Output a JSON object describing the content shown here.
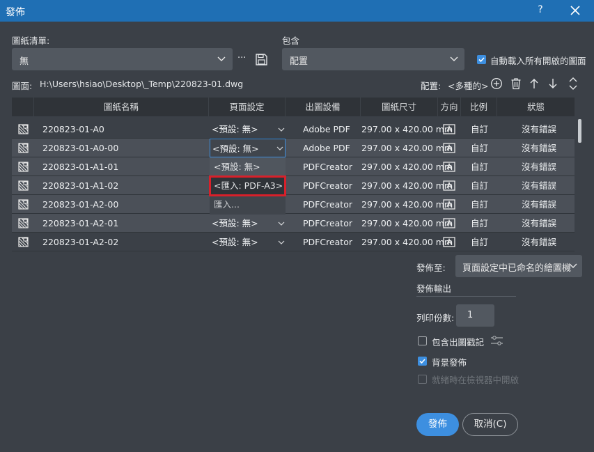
{
  "window": {
    "title": "發佈",
    "help": "?"
  },
  "sheet_list": {
    "label": "圖紙清單:",
    "value": "無",
    "more": "···"
  },
  "include": {
    "label": "包含",
    "value": "配置"
  },
  "auto_load": {
    "label": "自動載入所有開啟的圖面",
    "checked": true
  },
  "drawing": {
    "label": "圖面:",
    "path": "H:\\Users\\hsiao\\Desktop\\_Temp\\220823-01.dwg"
  },
  "layout": {
    "label": "配置:",
    "value": "<多種的>"
  },
  "table": {
    "headers": [
      "圖紙名稱",
      "頁面設定",
      "出圖設備",
      "圖紙尺寸",
      "方向",
      "比例",
      "狀態"
    ],
    "rows": [
      {
        "name": "220823-01-A0",
        "page_setup": "<預設: 無>",
        "device": "Adobe PDF",
        "size": "297.00 x 420.00 mm",
        "scale": "自訂",
        "status": "沒有錯誤"
      },
      {
        "name": "220823-01-A0-00",
        "page_setup": "<預設: 無>",
        "device": "Adobe PDF",
        "size": "297.00 x 420.00 mm",
        "scale": "自訂",
        "status": "沒有錯誤"
      },
      {
        "name": "220823-01-A1-01",
        "page_setup": "",
        "device": "PDFCreator",
        "size": "297.00 x 420.00 mm",
        "scale": "自訂",
        "status": "沒有錯誤"
      },
      {
        "name": "220823-01-A1-02",
        "page_setup": "",
        "device": "PDFCreator",
        "size": "297.00 x 420.00 mm",
        "scale": "自訂",
        "status": "沒有錯誤"
      },
      {
        "name": "220823-01-A2-00",
        "page_setup": "",
        "device": "PDFCreator",
        "size": "297.00 x 420.00 mm",
        "scale": "自訂",
        "status": "沒有錯誤"
      },
      {
        "name": "220823-01-A2-01",
        "page_setup": "<預設: 無>",
        "device": "PDFCreator",
        "size": "297.00 x 420.00 mm",
        "scale": "自訂",
        "status": "沒有錯誤"
      },
      {
        "name": "220823-01-A2-02",
        "page_setup": "<預設: 無>",
        "device": "PDFCreator",
        "size": "297.00 x 420.00 mm",
        "scale": "自訂",
        "status": "沒有錯誤"
      }
    ]
  },
  "dropdown": {
    "selected": "<預設: 無>",
    "options": [
      "<預設: 無>",
      "<匯入: PDF-A3>",
      "匯入..."
    ]
  },
  "publish_to": {
    "label": "發佈至:",
    "value": "頁面設定中已命名的繪圖機"
  },
  "publish_output": {
    "label": "發佈輸出"
  },
  "copies": {
    "label": "列印份數:",
    "value": "1"
  },
  "include_stamp": {
    "label": "包含出圖戳記",
    "checked": false
  },
  "background": {
    "label": "背景發佈",
    "checked": true
  },
  "open_viewer": {
    "label": "就緒時在檢視器中開啟",
    "checked": false,
    "disabled": true
  },
  "buttons": {
    "publish": "發佈",
    "cancel": "取消(C)"
  },
  "colors": {
    "accent": "#3d8fe0",
    "titlebar": "#1f6fb4",
    "highlight": "#d8202a",
    "background": "#3b4047"
  }
}
